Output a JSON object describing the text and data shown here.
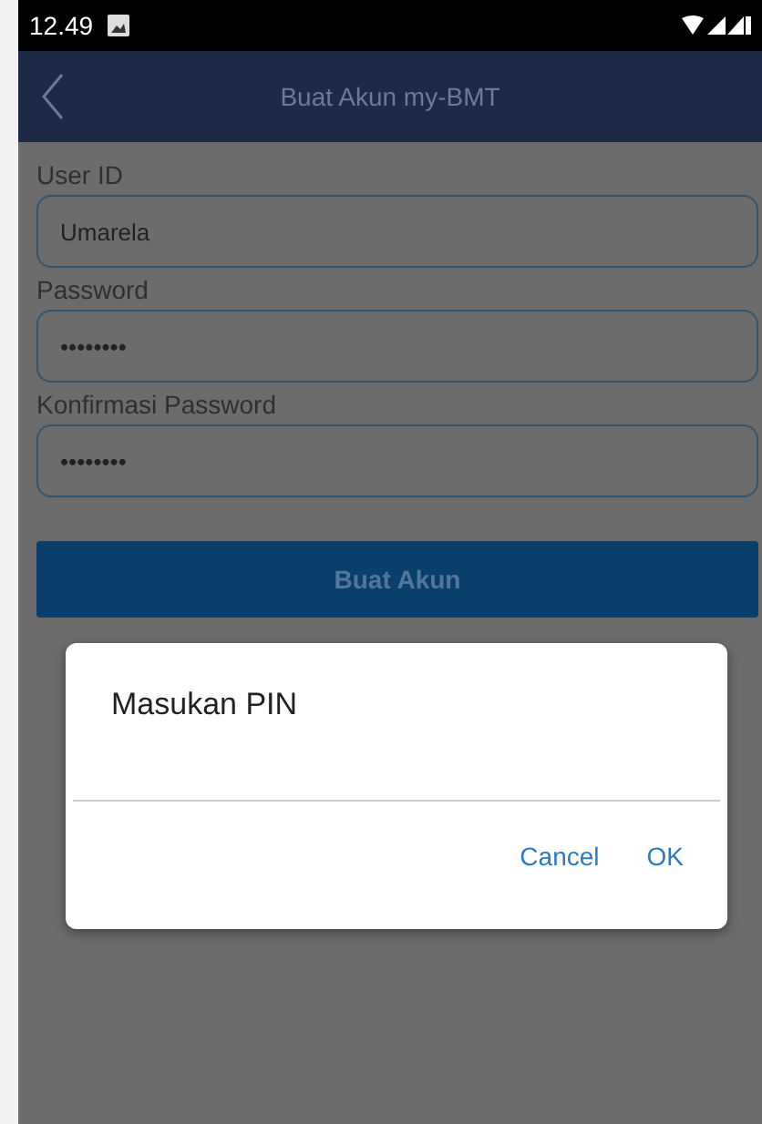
{
  "status_bar": {
    "time": "12.49"
  },
  "header": {
    "title": "Buat Akun my-BMT"
  },
  "fields": [
    {
      "label": "User ID",
      "value": "Umarela"
    },
    {
      "label": "Password",
      "value": "••••••••"
    },
    {
      "label": "Konfirmasi Password",
      "value": "••••••••"
    }
  ],
  "submit_button": "Buat Akun",
  "dialog": {
    "title": "Masukan PIN",
    "buttons": [
      "Cancel",
      "OK"
    ]
  }
}
